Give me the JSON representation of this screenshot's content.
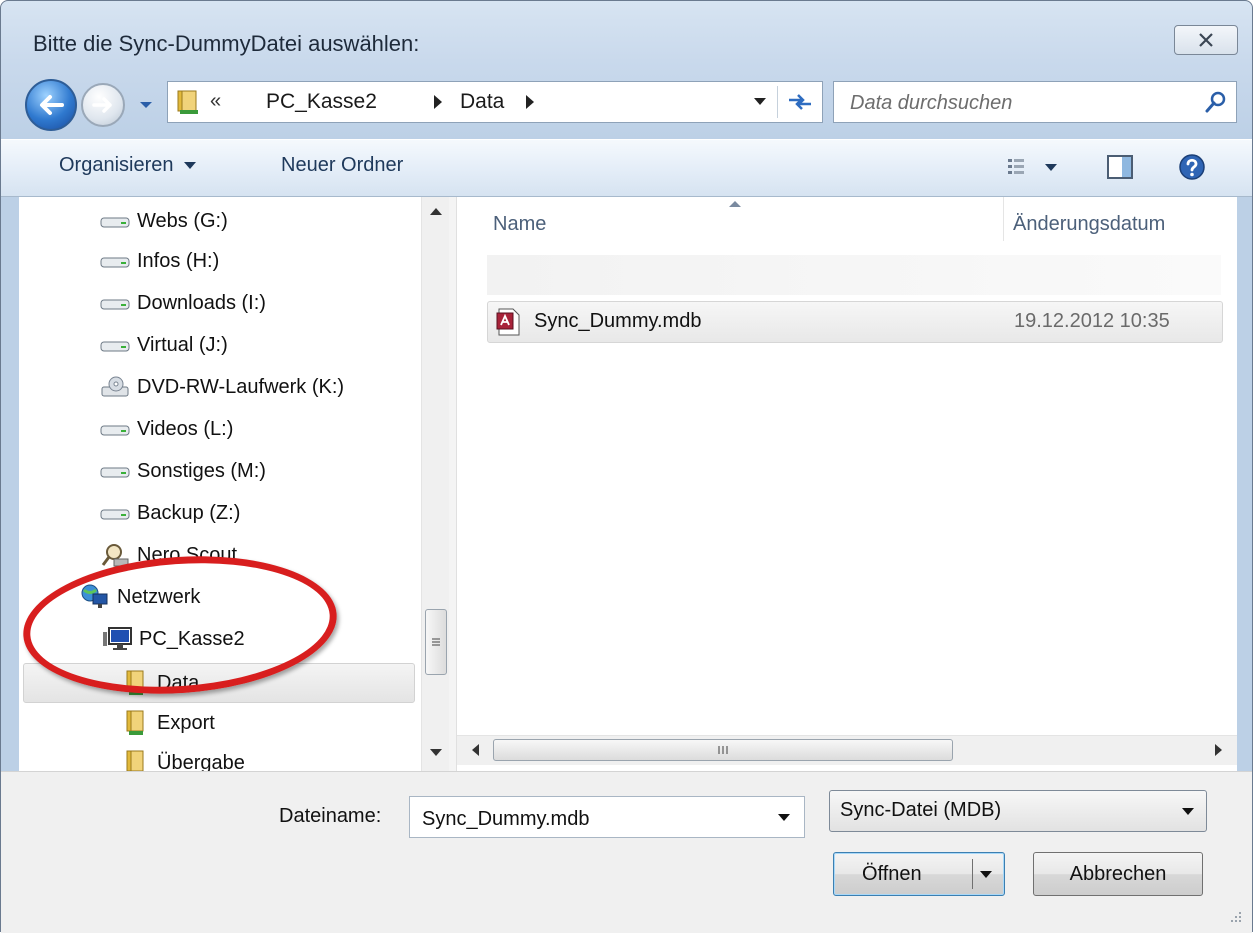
{
  "window": {
    "title": "Bitte die Sync-DummyDatei auswählen:",
    "close_symbol": "✕"
  },
  "address": {
    "overflow_chevron": "«",
    "segments": [
      "PC_Kasse2",
      "Data"
    ]
  },
  "search": {
    "placeholder": "Data durchsuchen"
  },
  "toolbar": {
    "organize_label": "Organisieren",
    "new_folder_label": "Neuer Ordner"
  },
  "tree": {
    "items": [
      {
        "label": "Webs (G:)",
        "icon": "drive-icon"
      },
      {
        "label": "Infos (H:)",
        "icon": "drive-icon"
      },
      {
        "label": "Downloads (I:)",
        "icon": "drive-icon"
      },
      {
        "label": "Virtual (J:)",
        "icon": "drive-icon"
      },
      {
        "label": "DVD-RW-Laufwerk (K:)",
        "icon": "dvd-drive-icon"
      },
      {
        "label": "Videos (L:)",
        "icon": "drive-icon"
      },
      {
        "label": "Sonstiges (M:)",
        "icon": "drive-icon"
      },
      {
        "label": "Backup (Z:)",
        "icon": "drive-icon"
      },
      {
        "label": "Nero Scout",
        "icon": "nero-scout-icon"
      },
      {
        "label": "Netzwerk",
        "icon": "network-icon"
      },
      {
        "label": "PC_Kasse2",
        "icon": "computer-icon"
      },
      {
        "label": "Data",
        "icon": "shared-folder-icon"
      },
      {
        "label": "Export",
        "icon": "shared-folder-icon"
      },
      {
        "label": "Übergabe",
        "icon": "shared-folder-icon"
      }
    ],
    "selected_index": 11
  },
  "filelist": {
    "columns": [
      "Name",
      "Änderungsdatum"
    ],
    "rows": [
      {
        "name": "Sync_Dummy.mdb",
        "modified": "19.12.2012 10:35",
        "icon": "access-database-icon"
      }
    ]
  },
  "footer": {
    "filename_label": "Dateiname:",
    "filename_value": "Sync_Dummy.mdb",
    "filetype_value": "Sync-Datei (MDB)",
    "open_label": "Öffnen",
    "cancel_label": "Abbrechen"
  },
  "colors": {
    "annotation": "#d81e1e",
    "toolbar_text": "#1e395b",
    "column_header_text": "#4c607a"
  }
}
